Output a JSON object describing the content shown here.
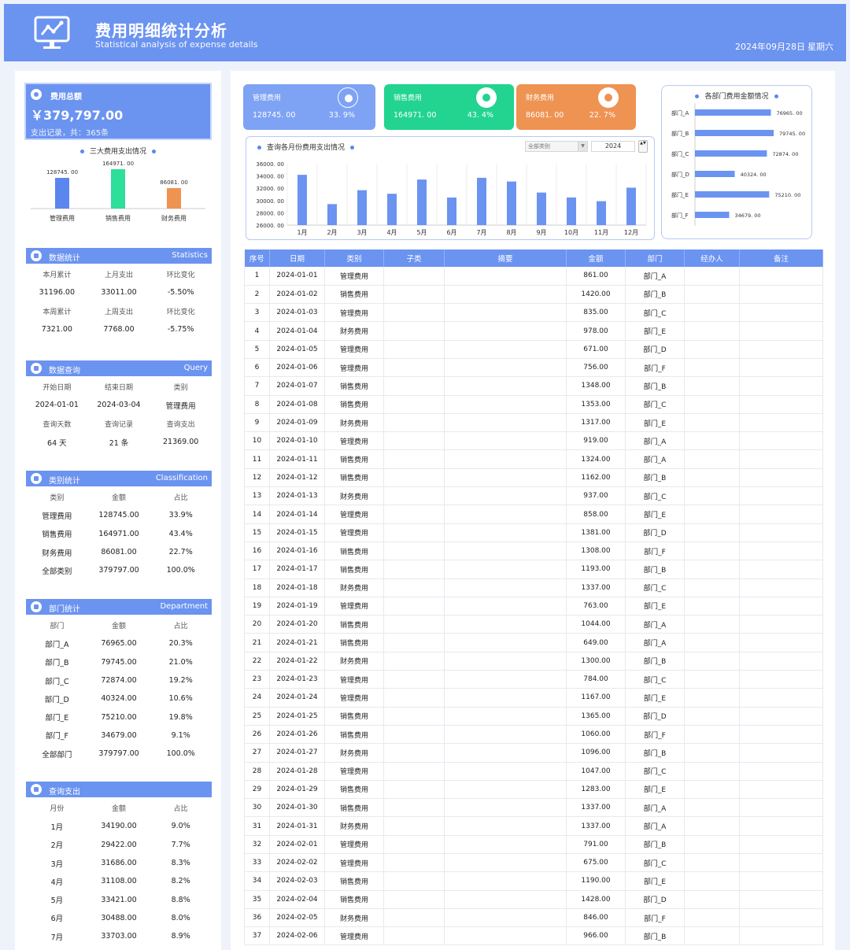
{
  "header": {
    "title": "费用明细统计分析",
    "subtitle": "Statistical analysis of expense details",
    "date": "2024年09月28日",
    "weekday": "星期六"
  },
  "summary": {
    "label": "费用总额",
    "total": "￥379,797.00",
    "records": "支出记录，共：365条",
    "chart_title": "三大费用支出情况"
  },
  "chart_data": [
    {
      "type": "bar",
      "title": "三大费用支出情况",
      "categories": [
        "管理费用",
        "销售费用",
        "财务费用"
      ],
      "values": [
        128745.0,
        164971.0,
        86081.0
      ],
      "value_labels": [
        "128745. 00",
        "164971. 00",
        "86081. 00"
      ],
      "colors": [
        "#5b86f0",
        "#2ddf9a",
        "#ef9353"
      ]
    },
    {
      "type": "bar",
      "title": "查询各月份费用支出情况",
      "categories": [
        "1月",
        "2月",
        "3月",
        "4月",
        "5月",
        "6月",
        "7月",
        "8月",
        "9月",
        "10月",
        "11月",
        "12月"
      ],
      "values": [
        34190,
        29422,
        31686,
        31108,
        33421,
        30488,
        33703,
        33100,
        31300,
        30500,
        29900,
        32100
      ],
      "yticks": [
        "36000. 00",
        "34000. 00",
        "32000. 00",
        "30000. 00",
        "28000. 00",
        "26000. 00"
      ],
      "ylim": [
        26000,
        36000
      ],
      "color": "#6b93f0"
    },
    {
      "type": "bar",
      "orientation": "horizontal",
      "title": "各部门费用金额情况",
      "categories": [
        "部门_A",
        "部门_B",
        "部门_C",
        "部门_D",
        "部门_E",
        "部门_F"
      ],
      "values": [
        76965.0,
        79745.0,
        72874.0,
        40324.0,
        75210.0,
        34679.0
      ],
      "value_labels": [
        "76965. 00",
        "79745. 00",
        "72874. 00",
        "40324. 00",
        "75210. 00",
        "34679. 00"
      ],
      "color": "#6b93f0"
    }
  ],
  "stats": {
    "title": "数据统计",
    "title_en": "Statistics",
    "rows": [
      [
        "本月累计",
        "上月支出",
        "环比变化"
      ],
      [
        "31196.00",
        "33011.00",
        "-5.50%"
      ],
      [
        "本周累计",
        "上周支出",
        "环比变化"
      ],
      [
        "7321.00",
        "7768.00",
        "-5.75%"
      ]
    ]
  },
  "query": {
    "title": "数据查询",
    "title_en": "Query",
    "rows": [
      [
        "开始日期",
        "结束日期",
        "类别"
      ],
      [
        "2024-01-01",
        "2024-03-04",
        "管理费用"
      ],
      [
        "查询天数",
        "查询记录",
        "查询支出"
      ],
      [
        "64 天",
        "21 条",
        "21369.00"
      ]
    ]
  },
  "classification": {
    "title": "类别统计",
    "title_en": "Classification",
    "rows": [
      [
        "类别",
        "金额",
        "占比"
      ],
      [
        "管理费用",
        "128745.00",
        "33.9%"
      ],
      [
        "销售费用",
        "164971.00",
        "43.4%"
      ],
      [
        "财务费用",
        "86081.00",
        "22.7%"
      ],
      [
        "全部类别",
        "379797.00",
        "100.0%"
      ]
    ]
  },
  "department": {
    "title": "部门统计",
    "title_en": "Department",
    "rows": [
      [
        "部门",
        "金额",
        "占比"
      ],
      [
        "部门_A",
        "76965.00",
        "20.3%"
      ],
      [
        "部门_B",
        "79745.00",
        "21.0%"
      ],
      [
        "部门_C",
        "72874.00",
        "19.2%"
      ],
      [
        "部门_D",
        "40324.00",
        "10.6%"
      ],
      [
        "部门_E",
        "75210.00",
        "19.8%"
      ],
      [
        "部门_F",
        "34679.00",
        "9.1%"
      ],
      [
        "全部部门",
        "379797.00",
        "100.0%"
      ]
    ]
  },
  "monthly": {
    "title": "查询支出",
    "title_en": "",
    "rows": [
      [
        "月份",
        "金额",
        "占比"
      ],
      [
        "1月",
        "34190.00",
        "9.0%"
      ],
      [
        "2月",
        "29422.00",
        "7.7%"
      ],
      [
        "3月",
        "31686.00",
        "8.3%"
      ],
      [
        "4月",
        "31108.00",
        "8.2%"
      ],
      [
        "5月",
        "33421.00",
        "8.8%"
      ],
      [
        "6月",
        "30488.00",
        "8.0%"
      ],
      [
        "7月",
        "33703.00",
        "8.9%"
      ]
    ]
  },
  "kpis": [
    {
      "name": "管理费用",
      "value": "128745. 00",
      "pct": "33. 9%",
      "color": "#7ea3f4",
      "dot": "#7ea3f4"
    },
    {
      "name": "销售费用",
      "value": "164971. 00",
      "pct": "43. 4%",
      "color": "#22d48f",
      "dot": "#22d48f"
    },
    {
      "name": "财务费用",
      "value": "86081. 00",
      "pct": "22. 7%",
      "color": "#ef9353",
      "dot": "#ef9353"
    }
  ],
  "month_filter": {
    "category": "全部类别",
    "year": "2024",
    "arrow": "▼",
    "spin": "▲▼"
  },
  "table": {
    "headers": [
      "序号",
      "日期",
      "类别",
      "子类",
      "摘要",
      "金额",
      "部门",
      "经办人",
      "备注"
    ],
    "rows": [
      [
        "1",
        "2024-01-01",
        "管理费用",
        "",
        "",
        "861.00",
        "部门_A",
        "",
        ""
      ],
      [
        "2",
        "2024-01-02",
        "销售费用",
        "",
        "",
        "1420.00",
        "部门_B",
        "",
        ""
      ],
      [
        "3",
        "2024-01-03",
        "管理费用",
        "",
        "",
        "835.00",
        "部门_C",
        "",
        ""
      ],
      [
        "4",
        "2024-01-04",
        "财务费用",
        "",
        "",
        "978.00",
        "部门_E",
        "",
        ""
      ],
      [
        "5",
        "2024-01-05",
        "管理费用",
        "",
        "",
        "671.00",
        "部门_D",
        "",
        ""
      ],
      [
        "6",
        "2024-01-06",
        "管理费用",
        "",
        "",
        "756.00",
        "部门_F",
        "",
        ""
      ],
      [
        "7",
        "2024-01-07",
        "销售费用",
        "",
        "",
        "1348.00",
        "部门_B",
        "",
        ""
      ],
      [
        "8",
        "2024-01-08",
        "销售费用",
        "",
        "",
        "1353.00",
        "部门_C",
        "",
        ""
      ],
      [
        "9",
        "2024-01-09",
        "财务费用",
        "",
        "",
        "1317.00",
        "部门_E",
        "",
        ""
      ],
      [
        "10",
        "2024-01-10",
        "管理费用",
        "",
        "",
        "919.00",
        "部门_A",
        "",
        ""
      ],
      [
        "11",
        "2024-01-11",
        "销售费用",
        "",
        "",
        "1324.00",
        "部门_A",
        "",
        ""
      ],
      [
        "12",
        "2024-01-12",
        "销售费用",
        "",
        "",
        "1162.00",
        "部门_B",
        "",
        ""
      ],
      [
        "13",
        "2024-01-13",
        "财务费用",
        "",
        "",
        "937.00",
        "部门_C",
        "",
        ""
      ],
      [
        "14",
        "2024-01-14",
        "管理费用",
        "",
        "",
        "858.00",
        "部门_E",
        "",
        ""
      ],
      [
        "15",
        "2024-01-15",
        "管理费用",
        "",
        "",
        "1381.00",
        "部门_D",
        "",
        ""
      ],
      [
        "16",
        "2024-01-16",
        "销售费用",
        "",
        "",
        "1308.00",
        "部门_F",
        "",
        ""
      ],
      [
        "17",
        "2024-01-17",
        "销售费用",
        "",
        "",
        "1193.00",
        "部门_B",
        "",
        ""
      ],
      [
        "18",
        "2024-01-18",
        "财务费用",
        "",
        "",
        "1337.00",
        "部门_C",
        "",
        ""
      ],
      [
        "19",
        "2024-01-19",
        "管理费用",
        "",
        "",
        "763.00",
        "部门_E",
        "",
        ""
      ],
      [
        "20",
        "2024-01-20",
        "销售费用",
        "",
        "",
        "1044.00",
        "部门_A",
        "",
        ""
      ],
      [
        "21",
        "2024-01-21",
        "销售费用",
        "",
        "",
        "649.00",
        "部门_A",
        "",
        ""
      ],
      [
        "22",
        "2024-01-22",
        "财务费用",
        "",
        "",
        "1300.00",
        "部门_B",
        "",
        ""
      ],
      [
        "23",
        "2024-01-23",
        "管理费用",
        "",
        "",
        "784.00",
        "部门_C",
        "",
        ""
      ],
      [
        "24",
        "2024-01-24",
        "管理费用",
        "",
        "",
        "1167.00",
        "部门_E",
        "",
        ""
      ],
      [
        "25",
        "2024-01-25",
        "销售费用",
        "",
        "",
        "1365.00",
        "部门_D",
        "",
        ""
      ],
      [
        "26",
        "2024-01-26",
        "销售费用",
        "",
        "",
        "1060.00",
        "部门_F",
        "",
        ""
      ],
      [
        "27",
        "2024-01-27",
        "财务费用",
        "",
        "",
        "1096.00",
        "部门_B",
        "",
        ""
      ],
      [
        "28",
        "2024-01-28",
        "管理费用",
        "",
        "",
        "1047.00",
        "部门_C",
        "",
        ""
      ],
      [
        "29",
        "2024-01-29",
        "销售费用",
        "",
        "",
        "1283.00",
        "部门_E",
        "",
        ""
      ],
      [
        "30",
        "2024-01-30",
        "销售费用",
        "",
        "",
        "1337.00",
        "部门_A",
        "",
        ""
      ],
      [
        "31",
        "2024-01-31",
        "财务费用",
        "",
        "",
        "1337.00",
        "部门_A",
        "",
        ""
      ],
      [
        "32",
        "2024-02-01",
        "管理费用",
        "",
        "",
        "791.00",
        "部门_B",
        "",
        ""
      ],
      [
        "33",
        "2024-02-02",
        "管理费用",
        "",
        "",
        "675.00",
        "部门_C",
        "",
        ""
      ],
      [
        "34",
        "2024-02-03",
        "销售费用",
        "",
        "",
        "1190.00",
        "部门_E",
        "",
        ""
      ],
      [
        "35",
        "2024-02-04",
        "销售费用",
        "",
        "",
        "1428.00",
        "部门_D",
        "",
        ""
      ],
      [
        "36",
        "2024-02-05",
        "财务费用",
        "",
        "",
        "846.00",
        "部门_F",
        "",
        ""
      ],
      [
        "37",
        "2024-02-06",
        "管理费用",
        "",
        "",
        "966.00",
        "部门_B",
        "",
        ""
      ]
    ]
  }
}
